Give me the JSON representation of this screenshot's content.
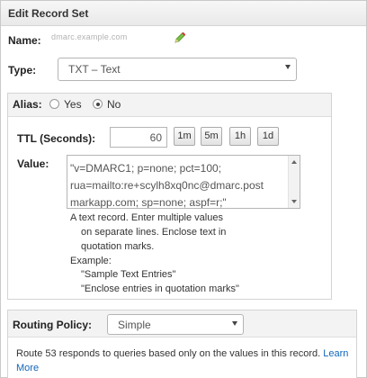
{
  "header": {
    "title": "Edit Record Set"
  },
  "name": {
    "label": "Name:",
    "value": "dmarc.example.com"
  },
  "type": {
    "label": "Type:",
    "selected": "TXT – Text"
  },
  "alias": {
    "label": "Alias:",
    "yes": "Yes",
    "no": "No",
    "selected": "No"
  },
  "ttl": {
    "label": "TTL (Seconds):",
    "value": "60",
    "buttons": [
      "1m",
      "5m",
      "1h",
      "1d"
    ]
  },
  "value": {
    "label": "Value:",
    "lines": [
      "\"v=DMARC1; p=none; pct=100;",
      "rua=mailto:re+scylh8xq0nc@dmarc.post",
      "markapp.com; sp=none; aspf=r;\""
    ],
    "help": [
      "A text record. Enter multiple values",
      "on separate lines. Enclose text in",
      "quotation marks.",
      "Example:",
      "\"Sample Text Entries\"",
      "\"Enclose entries in quotation marks\""
    ]
  },
  "routing": {
    "label": "Routing Policy:",
    "selected": "Simple",
    "description": "Route 53 responds to queries based only on the values in this record.",
    "learn_more": "Learn",
    "learn_more_2": "More"
  },
  "colors": {
    "link": "#1166bb",
    "header_bg": "#ececec"
  }
}
